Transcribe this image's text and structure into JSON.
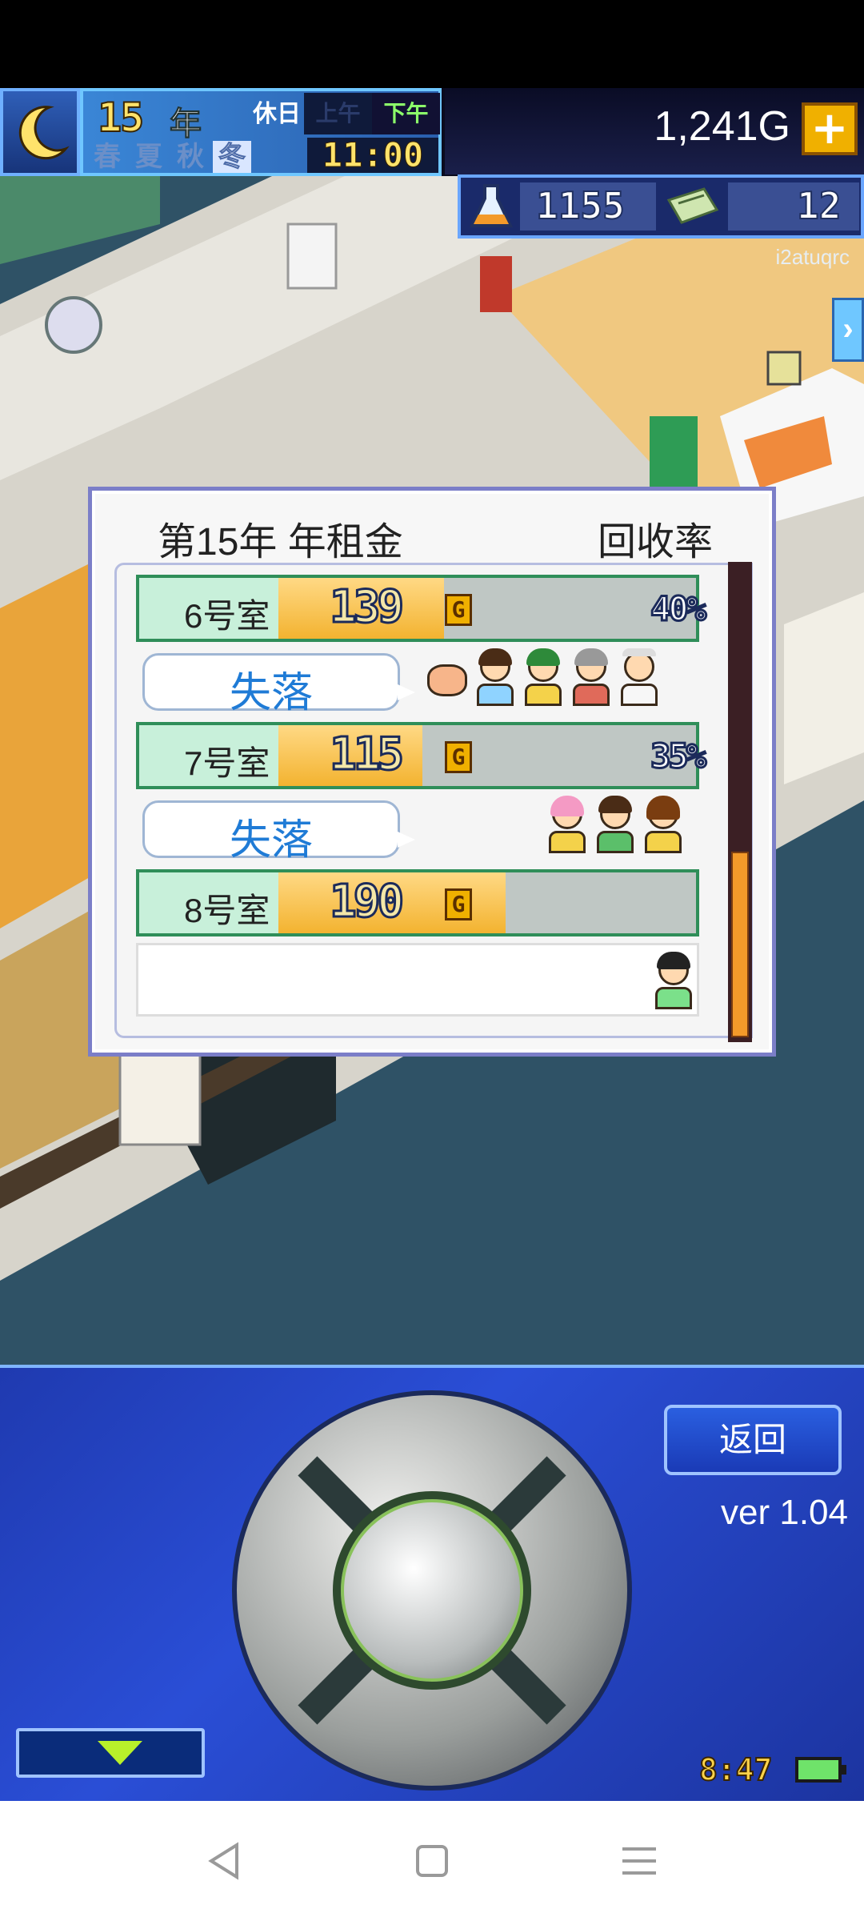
{
  "hud": {
    "year_number": "15",
    "year_unit": "年",
    "seasons": [
      "春",
      "夏",
      "秋",
      "冬"
    ],
    "active_season": "冬",
    "day_type": "休日",
    "am_label": "上午",
    "pm_label": "下午",
    "clock": "11:00",
    "money": "1,241G",
    "research_points": "1155",
    "tickets": "12",
    "watermark": "i2atuqrc"
  },
  "dialog": {
    "title": "第15年 年租金",
    "rate_header": "回收率",
    "rooms": [
      {
        "label": "6号室",
        "rent": "139",
        "rent_unit": "G",
        "rate": "40%",
        "rent_fill": 0.3,
        "status": "失落"
      },
      {
        "label": "7号室",
        "rent": "115",
        "rent_unit": "G",
        "rate": "35%",
        "rent_fill": 0.25,
        "status": "失落"
      },
      {
        "label": "8号室",
        "rent": "190",
        "rent_unit": "G",
        "rate": "",
        "rent_fill": 0.4,
        "status": ""
      }
    ]
  },
  "controls": {
    "back_label": "返回",
    "version": "ver 1.04",
    "system_time": "8:47"
  },
  "colors": {
    "accent_blue": "#2a4ed6",
    "bar_fill": "#f3b330",
    "bubble_text": "#1f7bd6",
    "scroll_thumb": "#f39a2a"
  }
}
